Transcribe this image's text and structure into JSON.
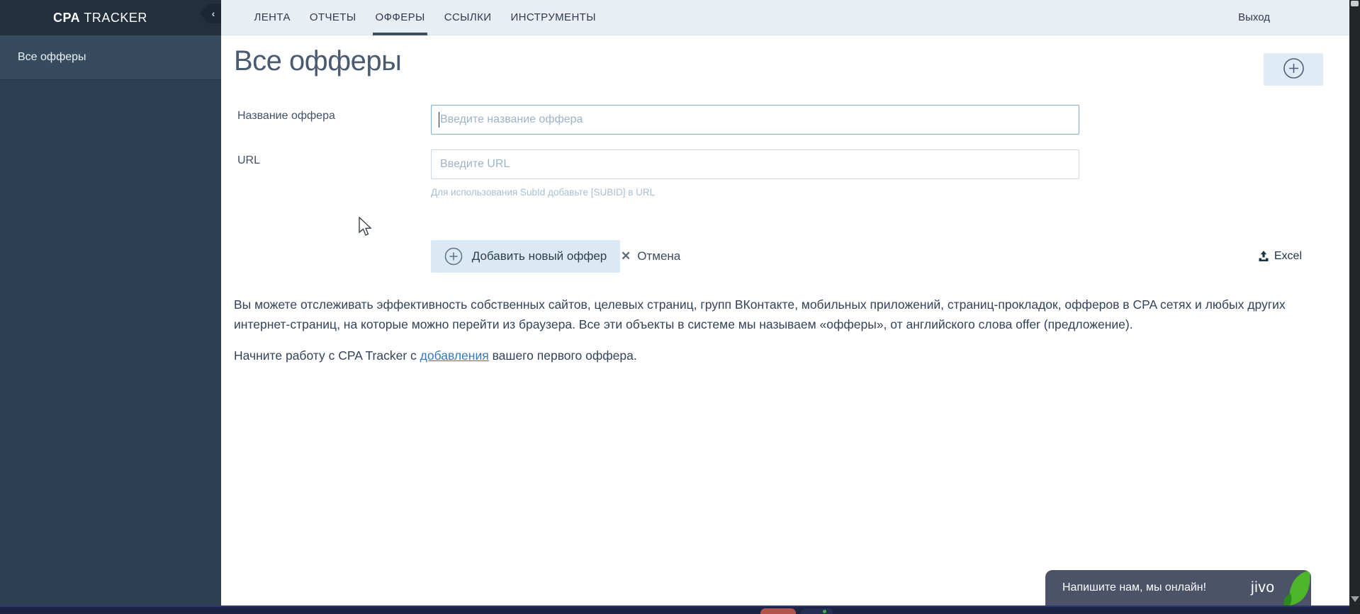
{
  "app": {
    "logo_bold": "CPA",
    "logo_rest": " TRACKER",
    "collapse_glyph": "‹"
  },
  "topnav": {
    "items": [
      {
        "label": "ЛЕНТА",
        "active": false
      },
      {
        "label": "ОТЧЕТЫ",
        "active": false
      },
      {
        "label": "ОФФЕРЫ",
        "active": true
      },
      {
        "label": "ССЫЛКИ",
        "active": false
      },
      {
        "label": "ИНСТРУМЕНТЫ",
        "active": false
      }
    ],
    "logout_label": "Выход"
  },
  "sidebar": {
    "items": [
      {
        "label": "Все офферы",
        "active": true
      }
    ]
  },
  "page": {
    "title": "Все офферы"
  },
  "form": {
    "name_label": "Название оффера",
    "name_placeholder": "Введите название оффера",
    "name_value": "",
    "url_label": "URL",
    "url_placeholder": "Введите URL",
    "url_value": "",
    "url_hint": "Для использования SubId добавьте [SUBID] в URL",
    "submit_label": "Добавить новый оффер",
    "cancel_label": "Отмена",
    "cancel_glyph": "✕",
    "excel_label": "Excel"
  },
  "intro": {
    "paragraph1": "Вы можете отслеживать эффективность собственных сайтов, целевых страниц, групп ВКонтакте, мобильных приложений, страниц-прокладок, офферов в CPA сетях и любых других интернет-страниц, на которые можно перейти из браузера. Все эти объекты в системе мы называем «офферы», от английского слова offer (предложение).",
    "paragraph2_before": "Начните работу с CPA Tracker с ",
    "paragraph2_link": "добавления",
    "paragraph2_after": " вашего первого оффера."
  },
  "chat": {
    "message": "Напишите нам, мы онлайн!",
    "brand": "jivo"
  },
  "colors": {
    "sidebar_bg": "#2d4053",
    "sidebar_header_bg": "#22303e",
    "sidebar_active_bg": "#374b5f",
    "topbar_bg": "#e8eef4",
    "button_bg": "#dbe9f4",
    "focus_border": "#7cb0d4",
    "link": "#3779be",
    "jivo_bg": "#4c5268",
    "jivo_green": "#4db62a"
  }
}
